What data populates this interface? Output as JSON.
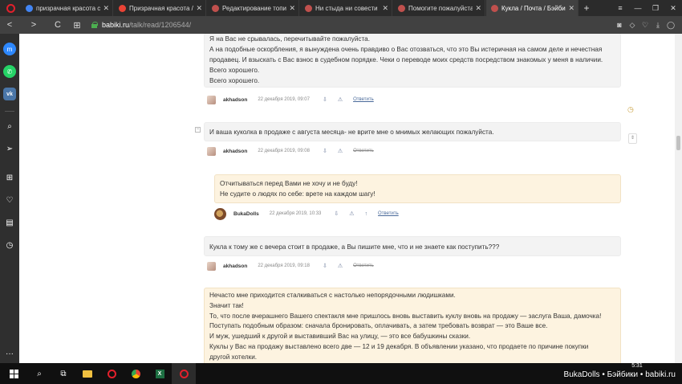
{
  "browser": {
    "tabs": [
      {
        "title": "призрачная красота сй",
        "favicon_color": "#4285f4",
        "active": false
      },
      {
        "title": "Призрачная красота / С",
        "favicon_color": "#ea4335",
        "active": false
      },
      {
        "title": "Редактирование топика",
        "favicon_color": "#c0504d",
        "active": false
      },
      {
        "title": "Ни стыда ни совести / Б",
        "favicon_color": "#c0504d",
        "active": false
      },
      {
        "title": "Помогите пожалуйста р",
        "favicon_color": "#c0504d",
        "active": false
      },
      {
        "title": "Кукла / Почта / Бэйбик",
        "favicon_color": "#c0504d",
        "active": true
      }
    ],
    "new_tab": "+",
    "url_host": "babiki.ru",
    "url_path": "/talk/read/1206544/",
    "window_controls": [
      "≡",
      "—",
      "❐",
      "✕"
    ],
    "nav": {
      "back": "<",
      "forward": ">",
      "reload": "C",
      "grid": "⊞"
    },
    "addr_icons": [
      "camera-icon",
      "shield-icon",
      "heart-icon",
      "download-icon",
      "user-icon"
    ]
  },
  "sidebar": {
    "apps": [
      {
        "name": "messenger",
        "glyph": "m"
      },
      {
        "name": "whatsapp",
        "glyph": "✆"
      },
      {
        "name": "vk",
        "glyph": "vk"
      }
    ],
    "tools": [
      "search-icon",
      "send-icon",
      "speed-dial-icon",
      "heart-icon",
      "news-icon",
      "history-icon",
      "more-icon"
    ]
  },
  "comments": [
    {
      "style": "grey",
      "lines": [
        "Я на Вас не срывалась, перечитывайте пожалуйста.",
        "А на подобные оскорбления, я вынуждена очень правдиво о Вас отозваться, что это Вы истеричная на самом деле и нечестная",
        "продавец. И взыскать с Вас взнос в судебном порядке. Чеки о переводе моих средств посредством знакомых у меня в наличии.",
        "Всего хорошего.",
        "Всего хорошего."
      ],
      "author": "akhadson",
      "date": "22 декабря 2019, 09:07",
      "reply": "Ответить",
      "reply_struck": false
    },
    {
      "style": "grey",
      "lines": [
        "И ваша куколка в продаже с августа месяца- не врите мне о мнимых желающих пожалуйста."
      ],
      "author": "akhadson",
      "date": "22 декабря 2019, 09:08",
      "reply": "Ответить",
      "reply_struck": true
    },
    {
      "style": "yellow",
      "lines": [
        "Отчитываться перед Вами не хочу и не буду!",
        "Не судите о людях по себе: врете на каждом шагу!"
      ],
      "author": "BukaDolls",
      "date": "22 декабря 2019, 10:33",
      "reply": "Ответить",
      "reply_struck": false
    },
    {
      "style": "grey",
      "lines": [
        "Кукла к тому же с вечера стоит в продаже, а Вы пишите мне, что и не знаете как поступить???"
      ],
      "author": "akhadson",
      "date": "22 декабря 2019, 09:18",
      "reply": "Ответить",
      "reply_struck": true
    },
    {
      "style": "yellow",
      "lines": [
        "Нечасто мне приходится сталкиваться с настолько непорядочными людишками.",
        "Значит так!",
        "То, что после вчерашнего Вашего спектакля мне пришлось вновь выставить куклу вновь на продажу — заслуга Ваша, дамочка!",
        "Поступать подобным образом: сначала бронировать, оплачивать, а затем требовать возврат — это Ваше все.",
        "И муж, ушедший к другой и выставивший Вас на улицу, — это все бабушкины сказки.",
        "Куклы у Вас на продажу выставлено всего две — 12 и 19 декабря. В объявлении указано, что продаете по причине покупки",
        "другой хотелки."
      ]
    }
  ],
  "taskbar": {
    "time": "5:31",
    "watermark": "BukaDolls • Бэйбики • babiki.ru"
  }
}
